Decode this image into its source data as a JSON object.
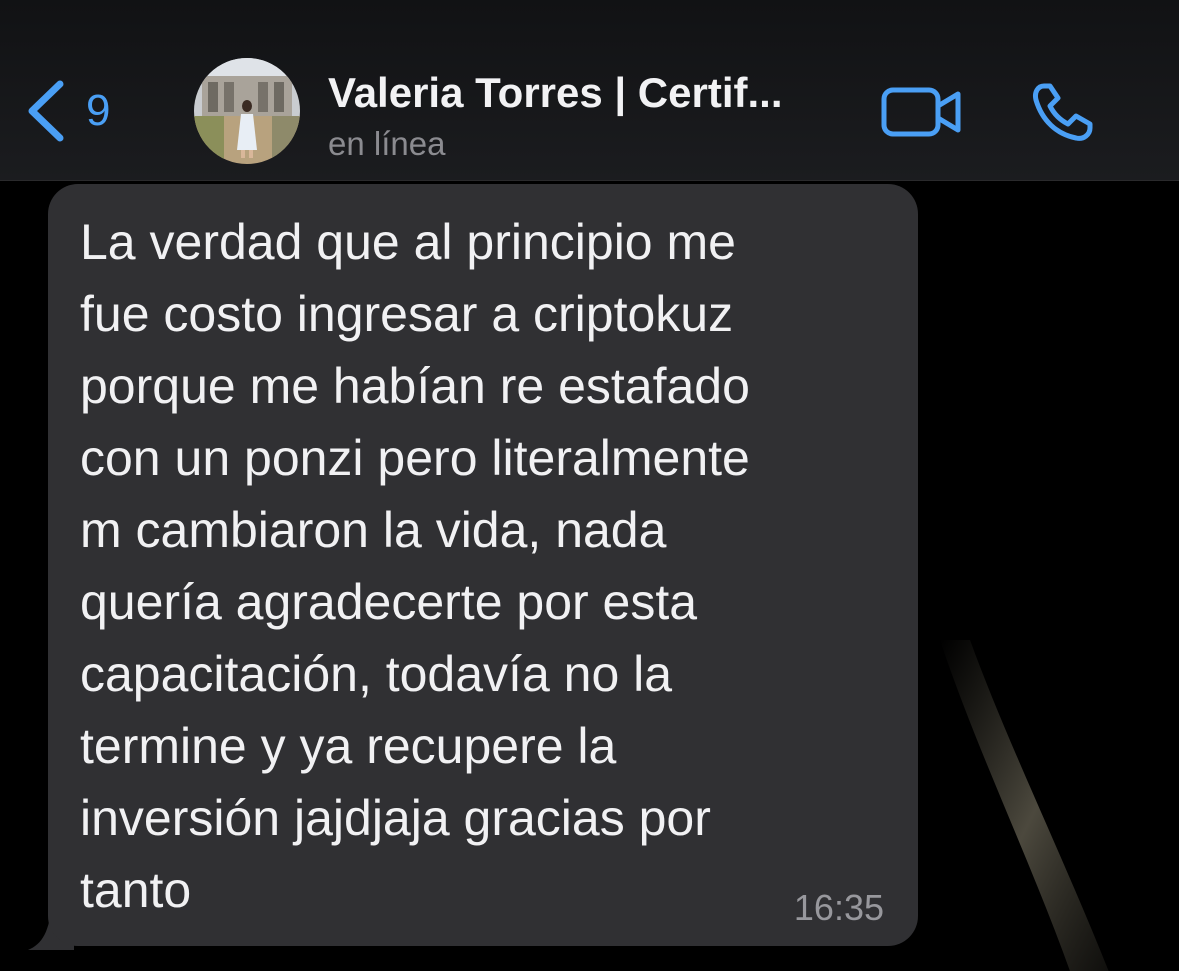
{
  "header": {
    "back_count": "9",
    "contact_name": "Valeria Torres | Certif...",
    "contact_status": "en línea",
    "accent_color": "#4a9ff5",
    "icons": {
      "back": "chevron-left-icon",
      "video": "video-camera-icon",
      "voice": "phone-icon"
    }
  },
  "message": {
    "direction": "incoming",
    "text": "La verdad que al principio me\nfue costo ingresar a criptokuz\nporque me habían re estafado\ncon un ponzi pero literalmente\nm cambiaron la vida, nada\nquería agradecerte por esta\ncapacitación, todavía no la\ntermine y ya recupere la\ninversión jajdjaja gracias por\ntanto",
    "time": "16:35",
    "bubble_color": "#303033"
  }
}
